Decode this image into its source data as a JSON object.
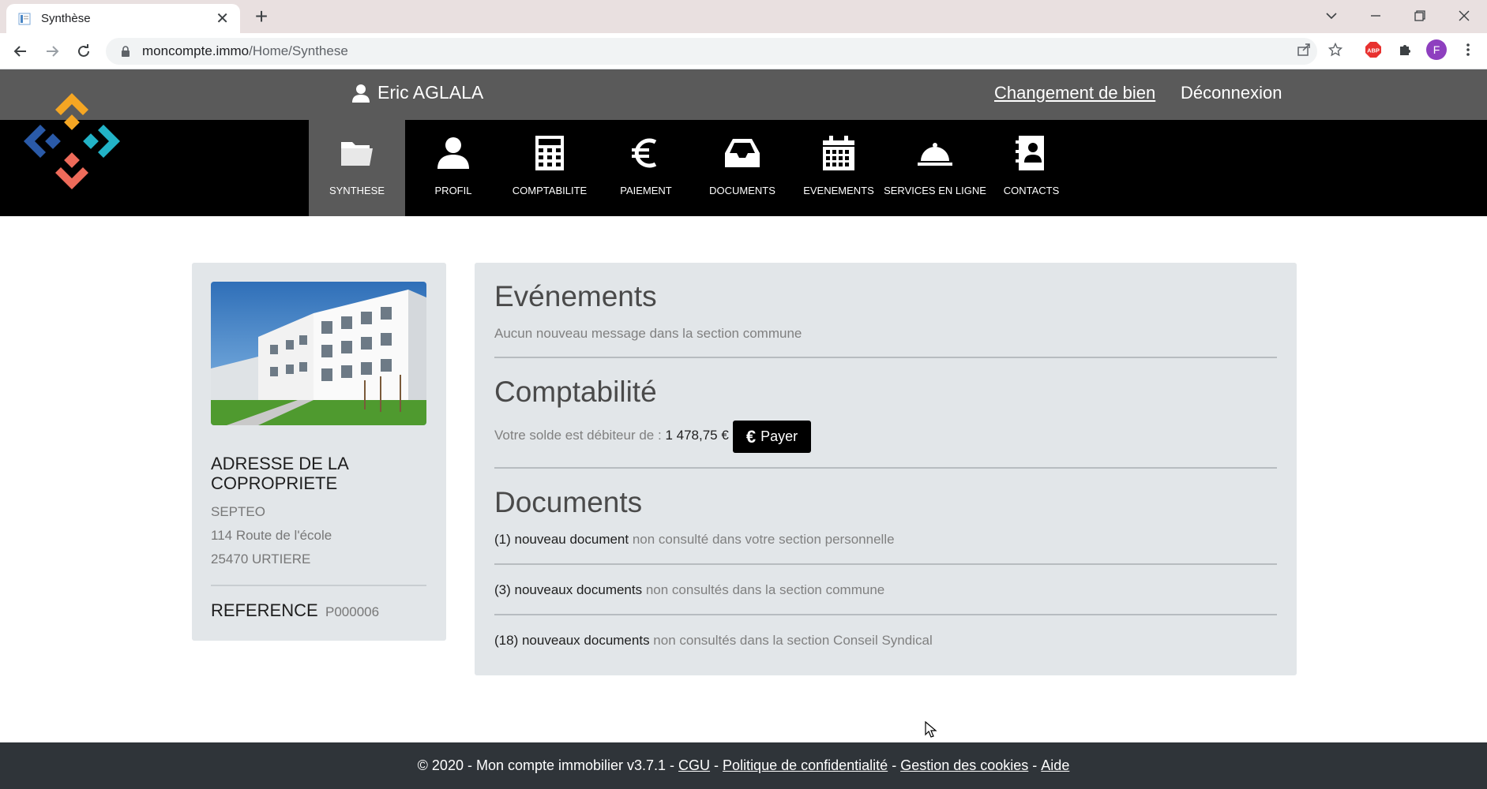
{
  "browser": {
    "tab_title": "Synthèse",
    "url_host": "moncompte.immo",
    "url_path": "/Home/Synthese",
    "profile_initial": "F",
    "extension_badge": "ABP"
  },
  "header": {
    "user_name": "Eric AGLALA",
    "change_property_link": "Changement de bien",
    "logout_link": "Déconnexion"
  },
  "nav": {
    "items": [
      {
        "label": "SYNTHESE",
        "icon": "folder-icon"
      },
      {
        "label": "PROFIL",
        "icon": "user-icon"
      },
      {
        "label": "COMPTABILITE",
        "icon": "calculator-icon"
      },
      {
        "label": "PAIEMENT",
        "icon": "euro-icon"
      },
      {
        "label": "DOCUMENTS",
        "icon": "inbox-icon"
      },
      {
        "label": "EVENEMENTS",
        "icon": "calendar-icon"
      },
      {
        "label": "SERVICES EN LIGNE",
        "icon": "service-bell-icon"
      },
      {
        "label": "CONTACTS",
        "icon": "address-book-icon"
      }
    ],
    "active": "SYNTHESE"
  },
  "property": {
    "title": "ADRESSE DE LA COPROPRIETE",
    "lines": [
      "SEPTEO",
      "114 Route de l'école",
      "25470 URTIERE"
    ],
    "reference_label": "REFERENCE",
    "reference_value": "P000006"
  },
  "events": {
    "title": "Evénements",
    "message": "Aucun nouveau message dans la section commune"
  },
  "accounting": {
    "title": "Comptabilité",
    "balance_text": "Votre solde est débiteur de :",
    "balance_amount": "1 478,75 €",
    "pay_button": "Payer"
  },
  "documents": {
    "title": "Documents",
    "rows": [
      {
        "strong": "(1) nouveau document",
        "rest": " non consulté dans votre section personnelle"
      },
      {
        "strong": "(3) nouveaux documents",
        "rest": " non consultés dans la section commune"
      },
      {
        "strong": "(18) nouveaux documents",
        "rest": " non consultés dans la section Conseil Syndical"
      }
    ]
  },
  "footer": {
    "copyright": "© 2020 - Mon compte immobilier v3.7.1 - ",
    "links": [
      "CGU",
      "Politique de confidentialité",
      "Gestion des cookies",
      "Aide"
    ],
    "separator": " - "
  },
  "colors": {
    "topbar": "#5a5a5a",
    "nav_bg": "#000000",
    "card_bg": "#e2e6e9",
    "footer_bg": "#2f3439"
  }
}
